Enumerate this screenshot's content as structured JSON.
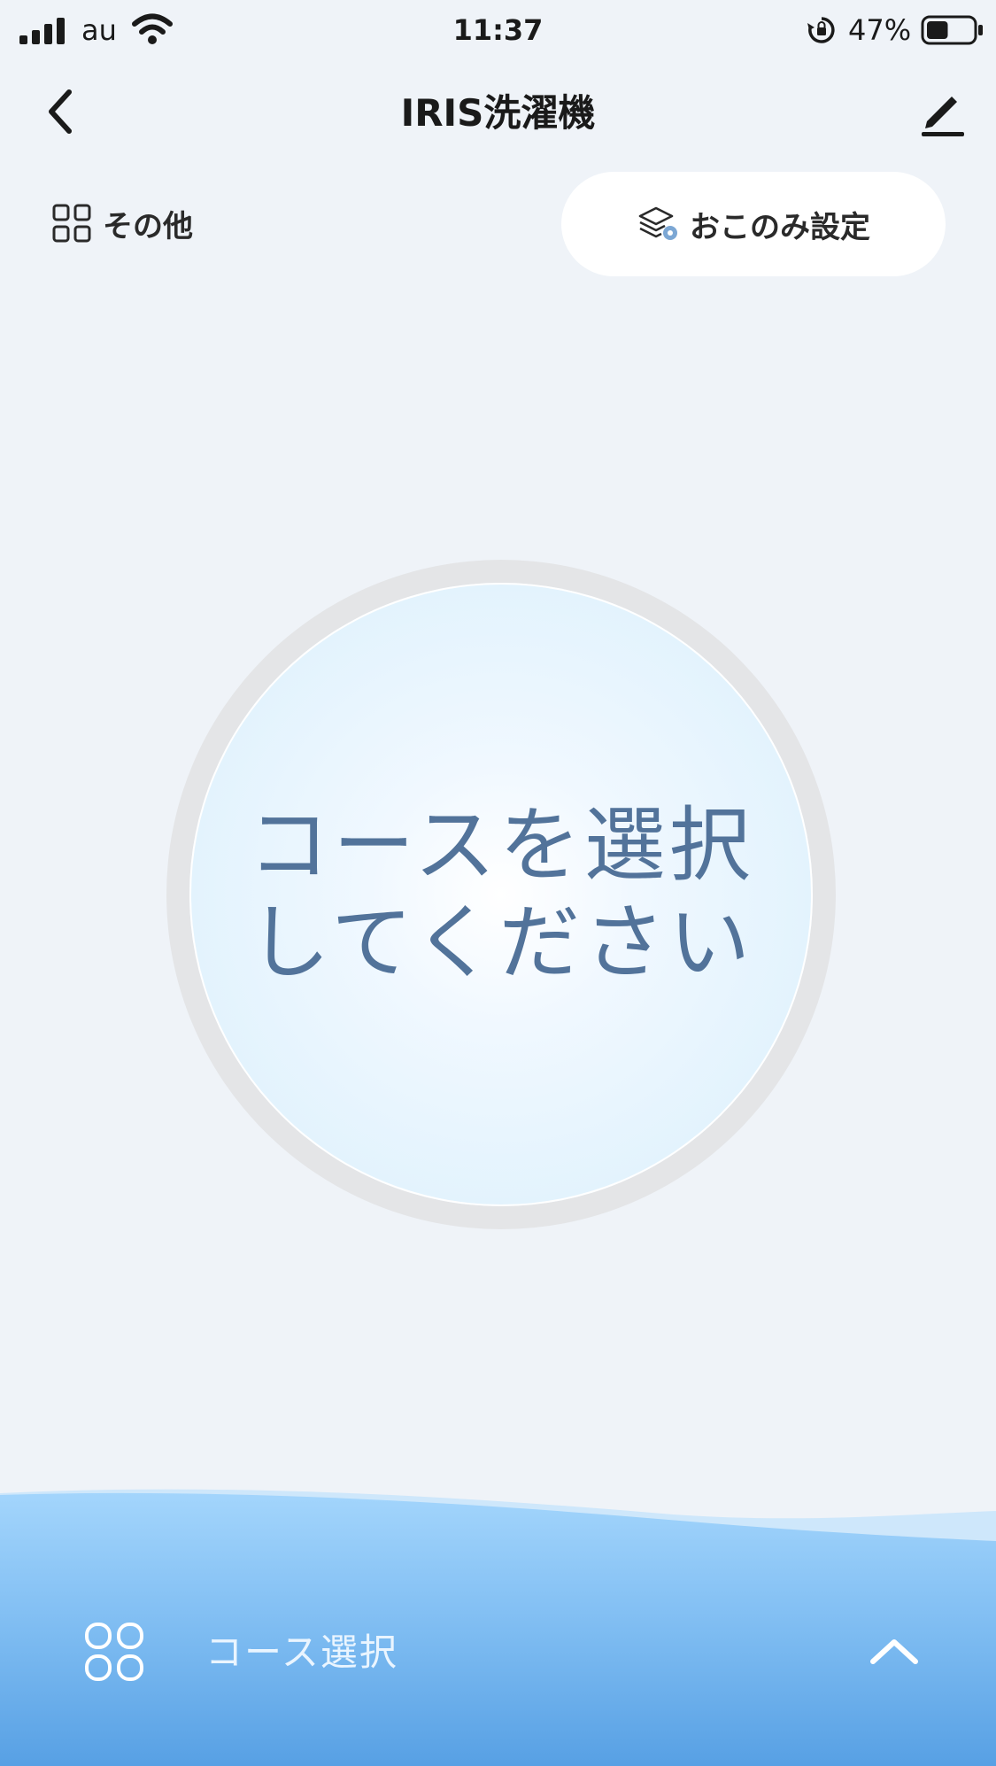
{
  "status_bar": {
    "carrier": "au",
    "time": "11:37",
    "battery_percent": "47%",
    "battery_level": 0.47,
    "icons": [
      "signal-icon",
      "wifi-icon",
      "rotation-lock-icon",
      "battery-icon"
    ]
  },
  "nav": {
    "title": "IRIS洗濯機",
    "back_icon": "chevron-left-icon",
    "edit_icon": "pencil-icon"
  },
  "toolbar": {
    "other_label": "その他",
    "other_icon": "grid-icon",
    "favorite_label": "おこのみ設定",
    "favorite_icon": "layers-settings-icon"
  },
  "dial": {
    "line1": "コースを選択",
    "line2": "してください"
  },
  "bottom": {
    "course_select_label": "コース選択",
    "course_icon": "grid-rounded-icon",
    "expand_icon": "chevron-up-icon"
  },
  "colors": {
    "background": "#eff3f8",
    "dial_text": "#52739a",
    "wave_top": "#9fd2fb",
    "wave_bottom": "#5aa3e6"
  }
}
